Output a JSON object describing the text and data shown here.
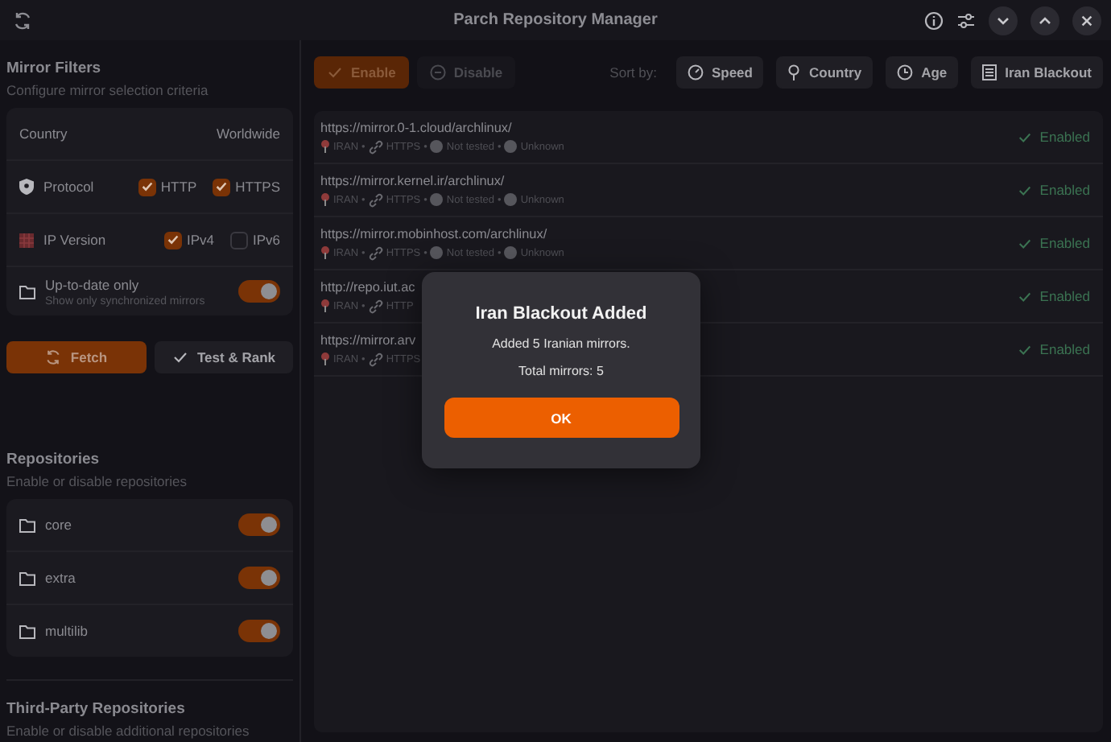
{
  "window": {
    "title": "Parch Repository Manager"
  },
  "sidebar": {
    "mirror_filters": {
      "title": "Mirror Filters",
      "subtitle": "Configure mirror selection criteria",
      "country": {
        "label": "Country",
        "value": "Worldwide"
      },
      "protocol": {
        "label": "Protocol",
        "options": [
          {
            "label": "HTTP",
            "checked": true
          },
          {
            "label": "HTTPS",
            "checked": true
          }
        ]
      },
      "ip_version": {
        "label": "IP Version",
        "options": [
          {
            "label": "IPv4",
            "checked": true
          },
          {
            "label": "IPv6",
            "checked": false
          }
        ]
      },
      "up_to_date": {
        "label": "Up-to-date only",
        "description": "Show only synchronized mirrors",
        "on": true
      }
    },
    "actions": [
      {
        "label": "Fetch",
        "kind": "primary"
      },
      {
        "label": "Test & Rank",
        "kind": "secondary"
      }
    ],
    "repositories": {
      "title": "Repositories",
      "subtitle": "Enable or disable repositories",
      "items": [
        {
          "name": "core",
          "on": true
        },
        {
          "name": "extra",
          "on": true
        },
        {
          "name": "multilib",
          "on": true
        }
      ]
    },
    "third_party": {
      "title": "Third-Party Repositories",
      "subtitle": "Enable or disable additional repositories"
    }
  },
  "toolbar": {
    "filters": [
      {
        "label": "Enable",
        "kind": "enable",
        "selected": true
      },
      {
        "label": "Disable",
        "kind": "disable",
        "selected": false
      }
    ],
    "sort_label": "Sort by:",
    "sort_options": [
      {
        "label": "Speed",
        "kind": "speed"
      },
      {
        "label": "Country",
        "kind": "country"
      },
      {
        "label": "Age",
        "kind": "age"
      },
      {
        "label": "Iran Blackout",
        "kind": "list"
      }
    ]
  },
  "separator": "•",
  "mirrors": [
    {
      "url": "https://mirror.0-1.cloud/archlinux/",
      "meta": [
        {
          "kind": "country",
          "text": "IRAN"
        },
        {
          "kind": "protocol",
          "text": "HTTPS"
        },
        {
          "kind": "status",
          "text": "Not tested"
        },
        {
          "kind": "status",
          "text": "Unknown"
        }
      ],
      "status": "Enabled",
      "enabled": true
    },
    {
      "url": "https://mirror.kernel.ir/archlinux/",
      "meta": [
        {
          "kind": "country",
          "text": "IRAN"
        },
        {
          "kind": "protocol",
          "text": "HTTPS"
        },
        {
          "kind": "status",
          "text": "Not tested"
        },
        {
          "kind": "status",
          "text": "Unknown"
        }
      ],
      "status": "Enabled",
      "enabled": true
    },
    {
      "url": "https://mirror.mobinhost.com/archlinux/",
      "meta": [
        {
          "kind": "country",
          "text": "IRAN"
        },
        {
          "kind": "protocol",
          "text": "HTTPS"
        },
        {
          "kind": "status",
          "text": "Not tested"
        },
        {
          "kind": "status",
          "text": "Unknown"
        }
      ],
      "status": "Enabled",
      "enabled": true
    },
    {
      "url": "http://repo.iut.ac",
      "meta": [
        {
          "kind": "country",
          "text": "IRAN"
        },
        {
          "kind": "protocol",
          "text": "HTTP"
        }
      ],
      "status": "Enabled",
      "enabled": true
    },
    {
      "url": "https://mirror.arv",
      "meta": [
        {
          "kind": "country",
          "text": "IRAN"
        },
        {
          "kind": "protocol",
          "text": "HTTPS"
        }
      ],
      "status": "Enabled",
      "enabled": true
    }
  ],
  "dialog": {
    "title": "Iran Blackout Added",
    "message": "Added 5 Iranian mirrors.",
    "detail": "Total mirrors: 5",
    "button": "OK"
  }
}
